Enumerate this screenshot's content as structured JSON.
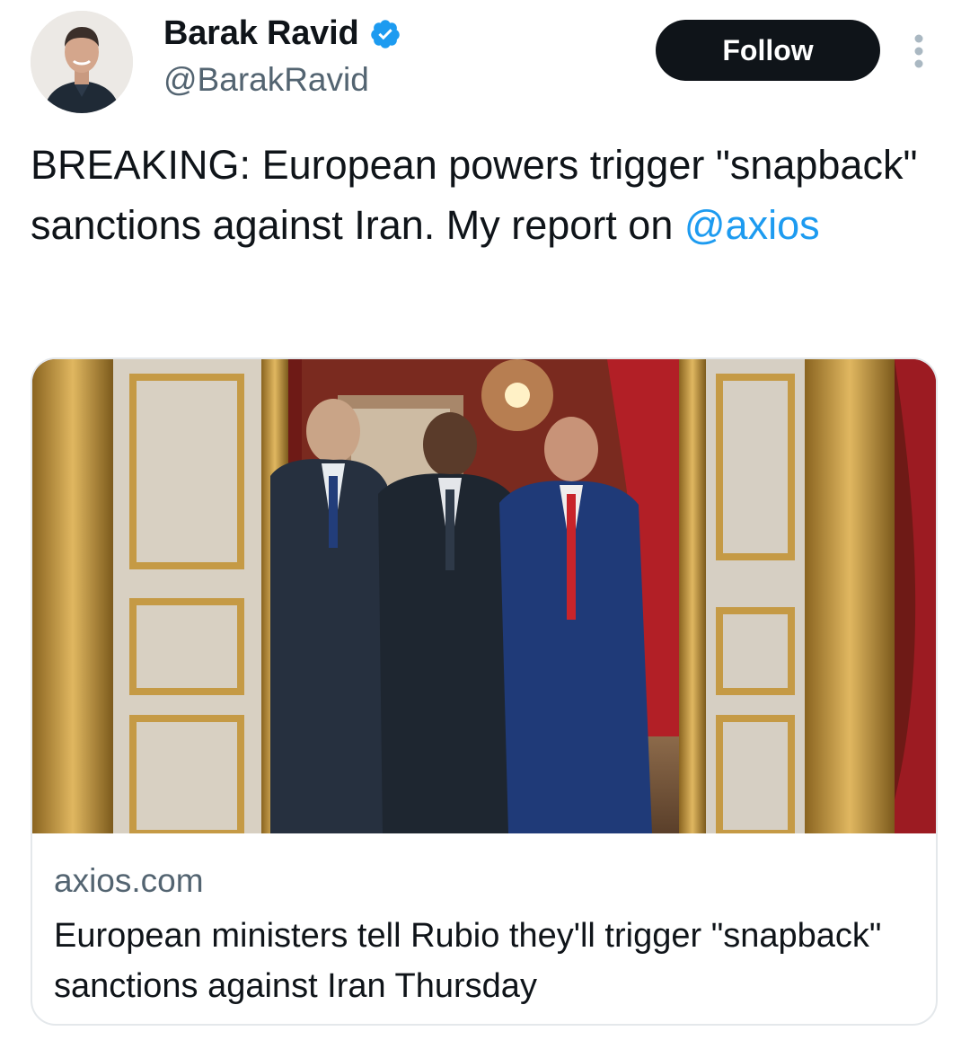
{
  "author": {
    "name": "Barak Ravid",
    "handle": "@BarakRavid",
    "verified": true,
    "avatar_icon": "profile-photo"
  },
  "actions": {
    "follow_label": "Follow",
    "more_icon": "more-vertical-icon"
  },
  "tweet": {
    "text_before": "BREAKING: European powers trigger \"snapback\" sanctions against Iran. My report on ",
    "mention": "@axios"
  },
  "card": {
    "domain": "axios.com",
    "title": "European ministers tell Rubio they'll trigger \"snapback\" sanctions against Iran Thursday",
    "image_icon": "article-photo"
  },
  "colors": {
    "text": "#0f1419",
    "secondary": "#536471",
    "link": "#1d9bf0",
    "verified_badge": "#1d9bf0",
    "button_bg": "#0f1419",
    "button_text": "#ffffff",
    "card_border": "#e4e8eb"
  }
}
